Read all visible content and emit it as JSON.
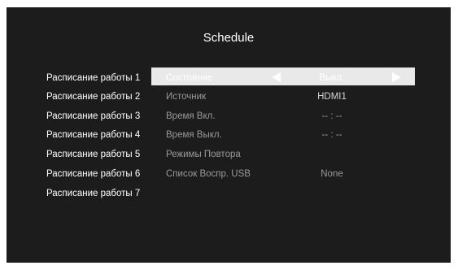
{
  "title": "Schedule",
  "schedules": [
    "Расписание работы 1",
    "Расписание работы 2",
    "Расписание работы 3",
    "Расписание работы 4",
    "Расписание работы 5",
    "Расписание работы 6",
    "Расписание работы 7"
  ],
  "settings": [
    {
      "label": "Состояние",
      "value": "Выкл."
    },
    {
      "label": "Источник",
      "value": "HDMI1"
    },
    {
      "label": "Время Вкл.",
      "value": "-- : --"
    },
    {
      "label": "Время Выкл.",
      "value": "-- : --"
    },
    {
      "label": "Режимы Повтора",
      "value": ""
    },
    {
      "label": "Список Воспр. USB",
      "value": "None"
    }
  ],
  "icons": {
    "left": "triangle-left-icon",
    "right": "triangle-right-icon"
  },
  "colors": {
    "background": "#1c1c1c",
    "highlight": "#e9e9e9",
    "text": "#ffffff",
    "dim_text": "#9a9a9a"
  }
}
